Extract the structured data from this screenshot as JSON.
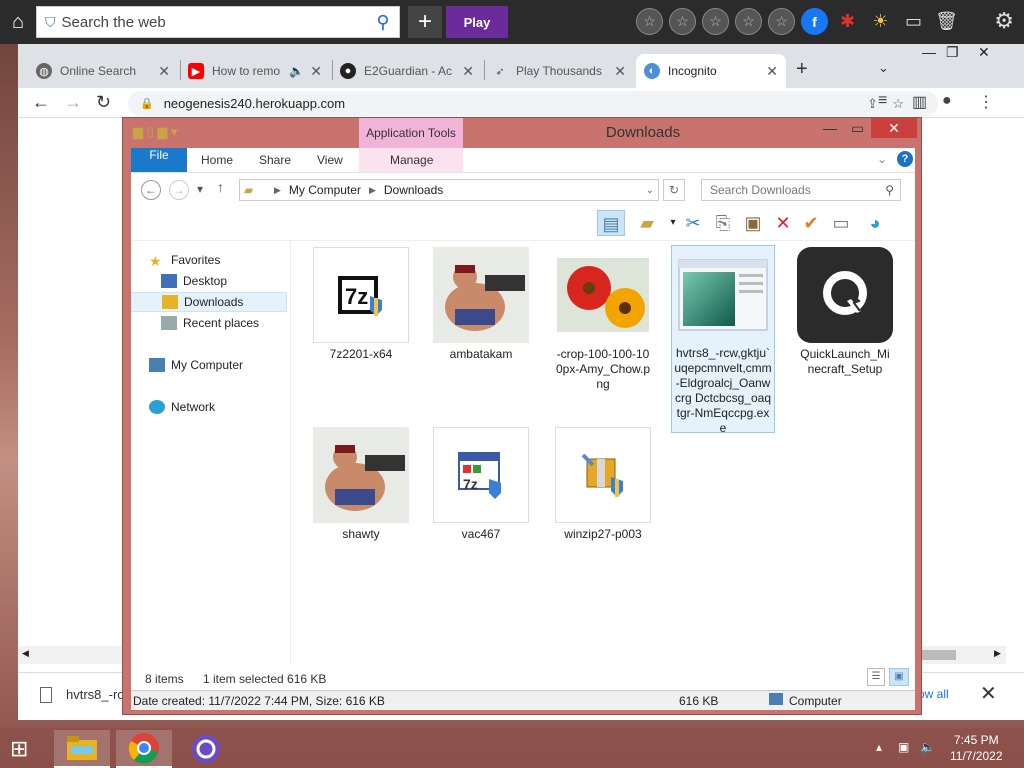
{
  "topbar": {
    "search_placeholder": "Search the web",
    "play_label": "Play"
  },
  "tabs": [
    {
      "label": "Online Search",
      "icon": "globe-icon"
    },
    {
      "label": "How to remo",
      "icon": "youtube-icon"
    },
    {
      "label": "E2Guardian - Ac",
      "icon": "github-icon"
    },
    {
      "label": "Play Thousands",
      "icon": "rocket-icon"
    },
    {
      "label": "Incognito",
      "icon": "incognito-icon"
    }
  ],
  "address": {
    "url": "neogenesis240.herokuapp.com"
  },
  "explorer": {
    "title": "Downloads",
    "contextual_tab": "Application Tools",
    "ribbon_tabs": [
      "File",
      "Home",
      "Share",
      "View",
      "Manage"
    ],
    "breadcrumb": [
      "My Computer",
      "Downloads"
    ],
    "search_placeholder": "Search Downloads",
    "nav": {
      "favorites": "Favorites",
      "desktop": "Desktop",
      "downloads": "Downloads",
      "recent": "Recent places",
      "computer": "My Computer",
      "network": "Network"
    },
    "files": [
      {
        "name": "7z2201-x64",
        "kind": "7zip-installer"
      },
      {
        "name": "ambatakam",
        "kind": "photo-soldier"
      },
      {
        "name": "-crop-100-100-100px-Amy_Chow.png",
        "kind": "photo-flowers"
      },
      {
        "name": "hvtrs8_-rcw,gktju`uqepcmnvelt,cmm-Eldgroalcj_Oanwcrg Dctcbcsg_oaqtgr-NmEqccpg.exe",
        "kind": "window-thumb",
        "selected": true
      },
      {
        "name": "QuickLaunch_Minecraft_Setup",
        "kind": "quicklaunch"
      },
      {
        "name": "shawty",
        "kind": "photo-soldier"
      },
      {
        "name": "vac467",
        "kind": "installer-window"
      },
      {
        "name": "winzip27-p003",
        "kind": "winzip-installer"
      }
    ],
    "status": {
      "items": "8 items",
      "selected": "1 item selected  616 KB",
      "details": "Date created: 11/7/2022 7:44 PM, Size: 616 KB",
      "size": "616 KB",
      "location": "Computer"
    }
  },
  "download_bar": {
    "filename": "hvtrs8_-rc",
    "show_all": "ow all"
  },
  "taskbar": {
    "time": "7:45 PM",
    "date": "11/7/2022"
  }
}
